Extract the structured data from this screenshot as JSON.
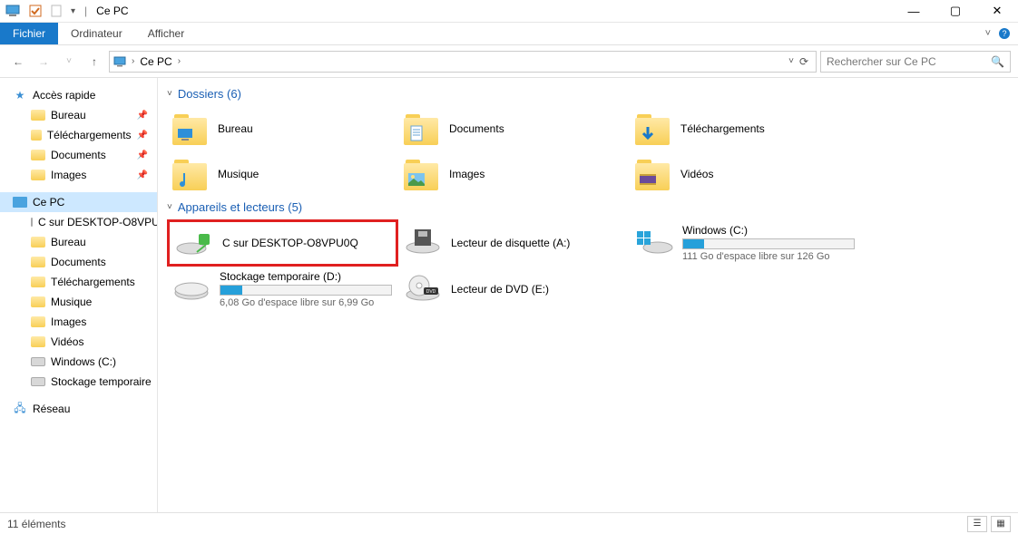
{
  "window": {
    "title": "Ce PC",
    "min": "—",
    "max": "▢",
    "close": "✕"
  },
  "ribbon": {
    "fichier": "Fichier",
    "ordinateur": "Ordinateur",
    "afficher": "Afficher"
  },
  "nav": {
    "back": "←",
    "forward": "→",
    "recent": "˅",
    "up": "↑",
    "refresh": "⟳"
  },
  "address": {
    "crumb1": "Ce PC",
    "sep": "›"
  },
  "search": {
    "placeholder": "Rechercher sur Ce PC"
  },
  "sidebar": {
    "quick": "Accès rapide",
    "bureau": "Bureau",
    "telechargements": "Téléchargements",
    "documents": "Documents",
    "images": "Images",
    "cepc": "Ce PC",
    "csur": "C sur DESKTOP-O8VPU",
    "bureau2": "Bureau",
    "documents2": "Documents",
    "telechargements2": "Téléchargements",
    "musique": "Musique",
    "images2": "Images",
    "videos": "Vidéos",
    "windowsc": "Windows (C:)",
    "stockage": "Stockage temporaire",
    "reseau": "Réseau"
  },
  "sections": {
    "dossiers": "Dossiers (6)",
    "lecteurs": "Appareils et lecteurs (5)"
  },
  "folders": {
    "bureau": "Bureau",
    "documents": "Documents",
    "telechargements": "Téléchargements",
    "musique": "Musique",
    "images": "Images",
    "videos": "Vidéos"
  },
  "drives": {
    "csur": {
      "title": "C sur DESKTOP-O8VPU0Q"
    },
    "floppy": {
      "title": "Lecteur de disquette (A:)"
    },
    "windows": {
      "title": "Windows (C:)",
      "sub": "111 Go d'espace libre sur 126 Go",
      "used_pct": 12
    },
    "stockage": {
      "title": "Stockage temporaire (D:)",
      "sub": "6,08 Go d'espace libre sur 6,99 Go",
      "used_pct": 13
    },
    "dvd": {
      "title": "Lecteur de DVD (E:)"
    }
  },
  "status": {
    "text": "11 éléments"
  }
}
